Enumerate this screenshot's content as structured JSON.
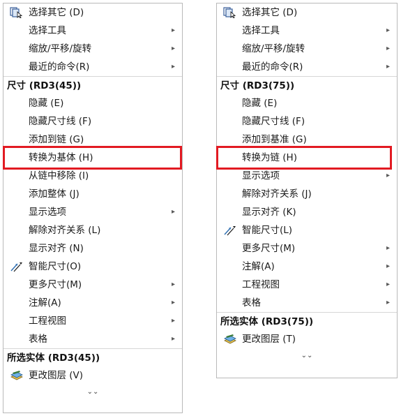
{
  "left_menu": {
    "top_items": [
      {
        "label": "选择其它 (D)",
        "icon": "select-other-icon",
        "submenu": false
      },
      {
        "label": "选择工具",
        "icon": "",
        "submenu": true
      },
      {
        "label": "缩放/平移/旋转",
        "icon": "",
        "submenu": true
      },
      {
        "label": "最近的命令(R)",
        "icon": "",
        "submenu": true
      }
    ],
    "dimension_header": "尺寸 (RD3(45))",
    "dimension_items": [
      {
        "label": "隐藏 (E)",
        "icon": "",
        "submenu": false
      },
      {
        "label": "隐藏尺寸线 (F)",
        "icon": "",
        "submenu": false
      },
      {
        "label": "添加到链 (G)",
        "icon": "",
        "submenu": false
      },
      {
        "label": "转换为基体 (H)",
        "icon": "",
        "submenu": false,
        "highlighted": true
      },
      {
        "label": "从链中移除 (I)",
        "icon": "",
        "submenu": false
      },
      {
        "label": "添加整体 (J)",
        "icon": "",
        "submenu": false
      },
      {
        "label": "显示选项",
        "icon": "",
        "submenu": true
      },
      {
        "label": "解除对齐关系 (L)",
        "icon": "",
        "submenu": false
      },
      {
        "label": "显示对齐 (N)",
        "icon": "",
        "submenu": false
      },
      {
        "label": "智能尺寸(O)",
        "icon": "smart-dimension-icon",
        "submenu": false
      },
      {
        "label": "更多尺寸(M)",
        "icon": "",
        "submenu": true
      },
      {
        "label": "注解(A)",
        "icon": "",
        "submenu": true
      },
      {
        "label": "工程视图",
        "icon": "",
        "submenu": true
      },
      {
        "label": "表格",
        "icon": "",
        "submenu": true
      }
    ],
    "selected_header": "所选实体 (RD3(45))",
    "selected_items": [
      {
        "label": "更改图层 (V)",
        "icon": "change-layer-icon",
        "submenu": false
      }
    ],
    "more_glyph": "⌄⌄"
  },
  "right_menu": {
    "top_items": [
      {
        "label": "选择其它 (D)",
        "icon": "select-other-icon",
        "submenu": false
      },
      {
        "label": "选择工具",
        "icon": "",
        "submenu": true
      },
      {
        "label": "缩放/平移/旋转",
        "icon": "",
        "submenu": true
      },
      {
        "label": "最近的命令(R)",
        "icon": "",
        "submenu": true
      }
    ],
    "dimension_header": "尺寸 (RD3(75))",
    "dimension_items": [
      {
        "label": "隐藏 (E)",
        "icon": "",
        "submenu": false
      },
      {
        "label": "隐藏尺寸线 (F)",
        "icon": "",
        "submenu": false
      },
      {
        "label": "添加到基准 (G)",
        "icon": "",
        "submenu": false
      },
      {
        "label": "转换为链 (H)",
        "icon": "",
        "submenu": false,
        "highlighted": true
      },
      {
        "label": "显示选项",
        "icon": "",
        "submenu": true
      },
      {
        "label": "解除对齐关系 (J)",
        "icon": "",
        "submenu": false
      },
      {
        "label": "显示对齐 (K)",
        "icon": "",
        "submenu": false
      },
      {
        "label": "智能尺寸(L)",
        "icon": "smart-dimension-icon",
        "submenu": false
      },
      {
        "label": "更多尺寸(M)",
        "icon": "",
        "submenu": true
      },
      {
        "label": "注解(A)",
        "icon": "",
        "submenu": true
      },
      {
        "label": "工程视图",
        "icon": "",
        "submenu": true
      },
      {
        "label": "表格",
        "icon": "",
        "submenu": true
      }
    ],
    "selected_header": "所选实体 (RD3(75))",
    "selected_items": [
      {
        "label": "更改图层 (T)",
        "icon": "change-layer-icon",
        "submenu": false
      }
    ],
    "more_glyph": "⌄⌄"
  },
  "colors": {
    "highlight_border": "#e21a22",
    "menu_border": "#b9b9b9",
    "separator": "#d6d6d6"
  }
}
